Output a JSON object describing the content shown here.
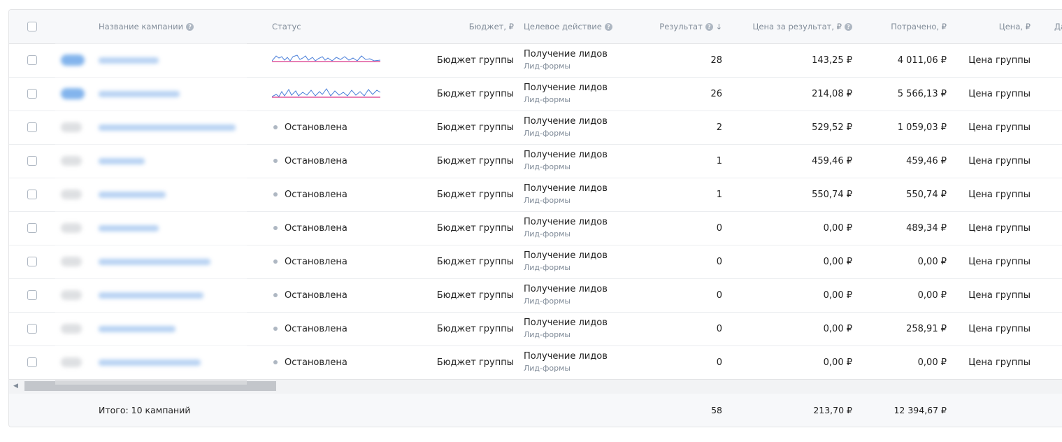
{
  "table": {
    "columns": {
      "name": "Название кампании",
      "status": "Статус",
      "budget": "Бюджет, ₽",
      "goal": "Целевое действие",
      "result": "Результат",
      "cost_per_result": "Цена за результат, ₽",
      "spent": "Потрачено, ₽",
      "price": "Цена, ₽",
      "next_cut": "Да"
    },
    "help_glyph": "?",
    "sort_glyph": "↓",
    "rows": [
      {
        "active": true,
        "status": "",
        "budget": "Бюджет группы",
        "goal": "Получение лидов",
        "goal_sub": "Лид-формы",
        "result": "28",
        "cost": "143,25 ₽",
        "spent": "4 011,06 ₽",
        "price": "Цена группы"
      },
      {
        "active": true,
        "status": "",
        "budget": "Бюджет группы",
        "goal": "Получение лидов",
        "goal_sub": "Лид-формы",
        "result": "26",
        "cost": "214,08 ₽",
        "spent": "5 566,13 ₽",
        "price": "Цена группы"
      },
      {
        "active": false,
        "status": "Остановлена",
        "budget": "Бюджет группы",
        "goal": "Получение лидов",
        "goal_sub": "Лид-формы",
        "result": "2",
        "cost": "529,52 ₽",
        "spent": "1 059,03 ₽",
        "price": "Цена группы"
      },
      {
        "active": false,
        "status": "Остановлена",
        "budget": "Бюджет группы",
        "goal": "Получение лидов",
        "goal_sub": "Лид-формы",
        "result": "1",
        "cost": "459,46 ₽",
        "spent": "459,46 ₽",
        "price": "Цена группы"
      },
      {
        "active": false,
        "status": "Остановлена",
        "budget": "Бюджет группы",
        "goal": "Получение лидов",
        "goal_sub": "Лид-формы",
        "result": "1",
        "cost": "550,74 ₽",
        "spent": "550,74 ₽",
        "price": "Цена группы"
      },
      {
        "active": false,
        "status": "Остановлена",
        "budget": "Бюджет группы",
        "goal": "Получение лидов",
        "goal_sub": "Лид-формы",
        "result": "0",
        "cost": "0,00 ₽",
        "spent": "489,34 ₽",
        "price": "Цена группы"
      },
      {
        "active": false,
        "status": "Остановлена",
        "budget": "Бюджет группы",
        "goal": "Получение лидов",
        "goal_sub": "Лид-формы",
        "result": "0",
        "cost": "0,00 ₽",
        "spent": "0,00 ₽",
        "price": "Цена группы"
      },
      {
        "active": false,
        "status": "Остановлена",
        "budget": "Бюджет группы",
        "goal": "Получение лидов",
        "goal_sub": "Лид-формы",
        "result": "0",
        "cost": "0,00 ₽",
        "spent": "0,00 ₽",
        "price": "Цена группы"
      },
      {
        "active": false,
        "status": "Остановлена",
        "budget": "Бюджет группы",
        "goal": "Получение лидов",
        "goal_sub": "Лид-формы",
        "result": "0",
        "cost": "0,00 ₽",
        "spent": "258,91 ₽",
        "price": "Цена группы"
      },
      {
        "active": false,
        "status": "Остановлена",
        "budget": "Бюджет группы",
        "goal": "Получение лидов",
        "goal_sub": "Лид-формы",
        "result": "0",
        "cost": "0,00 ₽",
        "spent": "0,00 ₽",
        "price": "Цена группы"
      }
    ],
    "footer": {
      "total_label": "Итого: 10 кампаний",
      "result": "58",
      "cost_per_result": "213,70 ₽",
      "spent": "12 394,67 ₽"
    }
  },
  "colors": {
    "accent": "#2d81e0",
    "sparkline": "#4a7fd9",
    "sparkline_baseline": "#e0569b",
    "stopped_dot": "#aeb7c2"
  },
  "icons": {
    "help": "question-circle-icon",
    "sort": "sort-desc-icon",
    "scroll_left": "scroll-left-arrow-icon"
  }
}
